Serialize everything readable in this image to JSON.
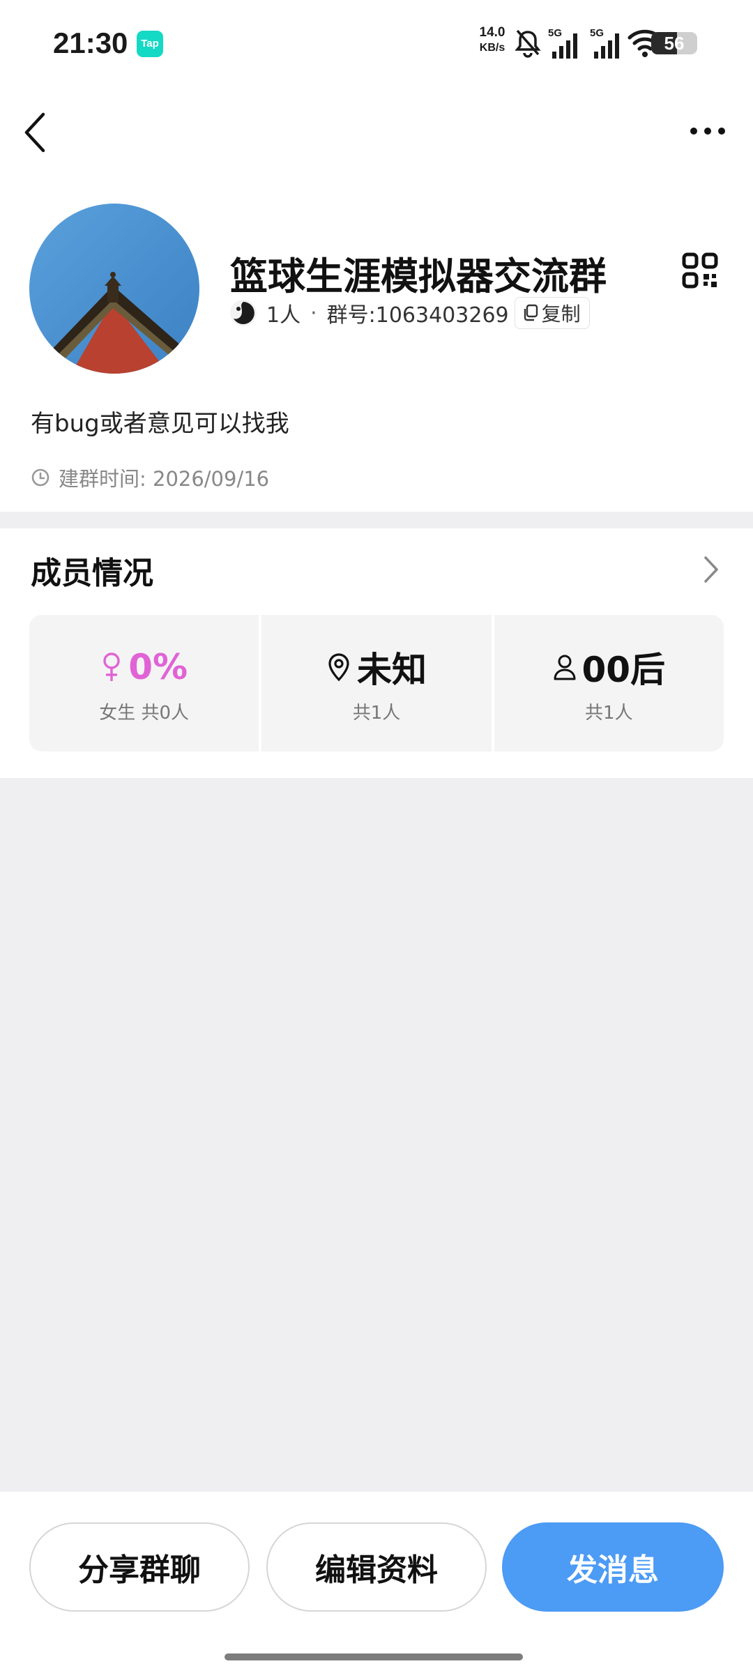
{
  "status_bar": {
    "time": "21:30",
    "app_badge": "Tap",
    "net_speed_value": "14.0",
    "net_speed_unit": "KB/s",
    "sim1_label": "5G",
    "sim2_label": "5G",
    "battery_percent": "56",
    "battery_level": 0.56
  },
  "header": {
    "group_name": "篮球生涯模拟器交流群",
    "member_count": "1人",
    "separator": "·",
    "group_id": "群号:1063403269",
    "copy_label": "复制"
  },
  "intro": "有bug或者意见可以找我",
  "created": "建群时间: 2026/09/16",
  "members": {
    "title": "成员情况",
    "stats": [
      {
        "value": "0%",
        "sub": "女生 共0人",
        "icon": "female-icon"
      },
      {
        "value": "未知",
        "sub": "共1人",
        "icon": "location-pin-icon"
      },
      {
        "value": "00后",
        "sub": "共1人",
        "icon": "person-icon"
      }
    ]
  },
  "actions": {
    "share_label": "分享群聊",
    "edit_label": "编辑资料",
    "message_label": "发消息"
  },
  "colors": {
    "accent_blue": "#4c9bf5",
    "female_pink": "#e063d6",
    "page_gray": "#efeff1",
    "tap_teal": "#14d9c5"
  }
}
